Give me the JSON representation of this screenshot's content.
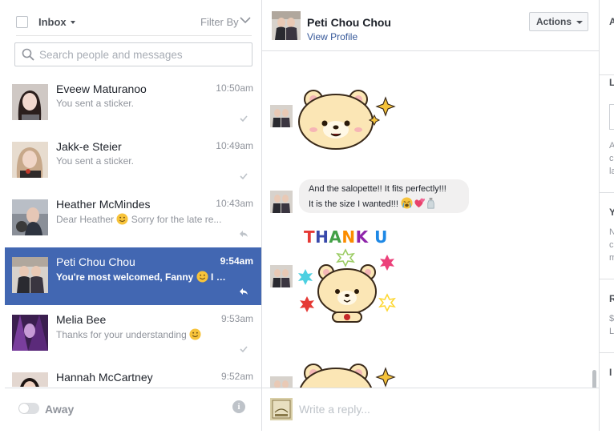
{
  "left": {
    "folder_label": "Inbox",
    "filter_label": "Filter By",
    "search_placeholder": "Search people and messages",
    "threads": [
      {
        "name": "Eveew Maturanoo",
        "time": "10:50am",
        "snippet": "You sent a sticker.",
        "status": "seen-check",
        "selected": false
      },
      {
        "name": "Jakk-e Steier",
        "time": "10:49am",
        "snippet": "You sent a sticker.",
        "status": "seen-check",
        "selected": false
      },
      {
        "name": "Heather McMindes",
        "time": "10:43am",
        "snippet_pre": "Dear Heather ",
        "snippet_post": " Sorry for the late re...",
        "status": "replied-arrow",
        "selected": false
      },
      {
        "name": "Peti Chou Chou",
        "time": "9:54am",
        "snippet_pre": "You're most welcomed, Fanny ",
        "snippet_post": " I a...",
        "status": "replied-arrow",
        "selected": true
      },
      {
        "name": "Melia Bee",
        "time": "9:53am",
        "snippet_pre": "Thanks for your understanding ",
        "snippet_post": "",
        "status": "seen-check",
        "selected": false
      },
      {
        "name": "Hannah McCartney",
        "time": "9:52am",
        "snippet": "",
        "status": "",
        "selected": false
      }
    ],
    "presence_label": "Away",
    "info_glyph": "i"
  },
  "conversation": {
    "contact_name": "Peti Chou Chou",
    "view_profile_label": "View Profile",
    "actions_label": "Actions",
    "message_line1": "And the salopette!! It fits perfectly!!!",
    "message_line2": "It is the size I wanted!!!",
    "sticker_text": "THANK U",
    "reply_placeholder": "Write a reply..."
  },
  "colors": {
    "selected_row": "#4267b2",
    "link": "#365899",
    "sticker_bear": "#fbe6b5",
    "sticker_text_colors": [
      "#e53935",
      "#3949ab",
      "#43a047",
      "#fb8c00",
      "#8e24aa",
      "#1e88e5",
      "#e91e63"
    ]
  }
}
